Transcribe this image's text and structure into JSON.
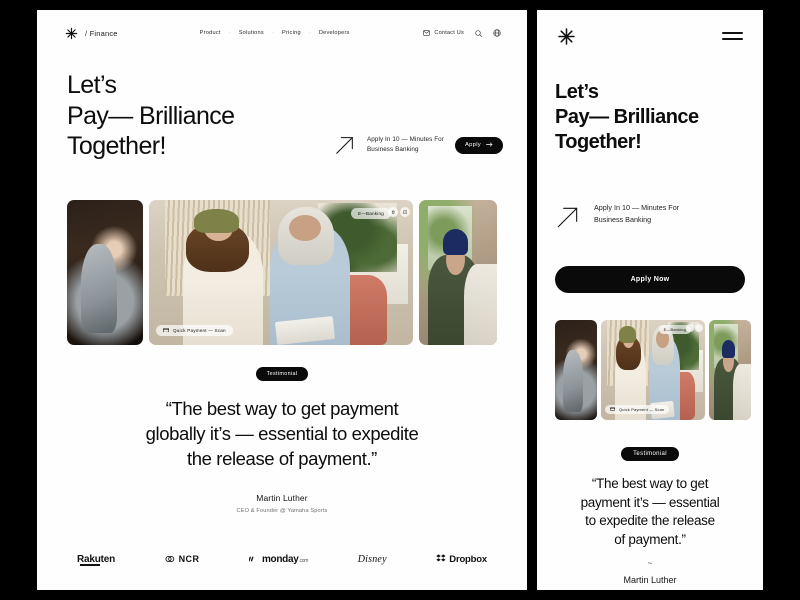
{
  "theme": {
    "page_background": "#000000",
    "panel_background": "#fefefe",
    "text_primary": "#0d0d0d",
    "text_muted": "#6f6f6f",
    "accent_dark": "#0a0a0a"
  },
  "desktop": {
    "header": {
      "logo_icon": "asterisk-icon",
      "brand": "/ Finance",
      "nav": [
        {
          "label": "Product"
        },
        {
          "label": "Solutions"
        },
        {
          "label": "Pricing"
        },
        {
          "label": "Developers"
        }
      ],
      "nav_separator": "·",
      "contact_icon": "mail-icon",
      "contact_label": "Contact Us",
      "search_icon": "search-icon",
      "globe_icon": "globe-icon"
    },
    "hero": {
      "headline_line1": "Let’s",
      "headline_line2": "Pay— Brilliance",
      "headline_line3": "Together!",
      "cta_icon": "arrow-up-right-icon",
      "cta_text_line1": "Apply In 10 — Minutes For",
      "cta_text_line2": "Business Banking",
      "apply_button": "Apply",
      "apply_button_icon": "arrow-right-icon"
    },
    "images": {
      "badge_quick_icon": "card-icon",
      "badge_quick_label": "Quick Payment — Scan",
      "badge_ebanking_label": "E—Banking",
      "ctrl_one_icon": "delete-icon",
      "ctrl_two_icon": "expand-icon"
    },
    "testimonial": {
      "tag": "Testimonial",
      "quote_line1": "“The best way to get payment",
      "quote_line2": "globally it’s — essential to expedite",
      "quote_line3": "the release of payment.”",
      "author": "Martin Luther",
      "role": "CEO & Founder @ Yamaha Sports"
    },
    "logos": [
      {
        "name": "Rakuten"
      },
      {
        "name": "NCR"
      },
      {
        "name": "monday",
        "suffix": ".com"
      },
      {
        "name": "Disney"
      },
      {
        "name": "Dropbox"
      }
    ]
  },
  "mobile": {
    "header": {
      "logo_icon": "asterisk-icon",
      "menu_icon": "hamburger-menu-icon"
    },
    "hero": {
      "headline_line1": "Let’s",
      "headline_line2": "Pay— Brilliance",
      "headline_line3": "Together!",
      "cta_icon": "arrow-up-right-icon",
      "cta_text_line1": "Apply In 10 — Minutes For",
      "cta_text_line2": "Business Banking",
      "apply_button": "Apply Now"
    },
    "images": {
      "badge_quick_label": "Quick Payment — Scan",
      "badge_ebanking_label": "E—Banking"
    },
    "testimonial": {
      "tag": "Testimonial",
      "quote_line1": "“The best way to get",
      "quote_line2": "payment  it’s — essential",
      "quote_line3": "to expedite  the release",
      "quote_line4": "of payment.”",
      "divider": "~",
      "author": "Martin Luther"
    }
  }
}
